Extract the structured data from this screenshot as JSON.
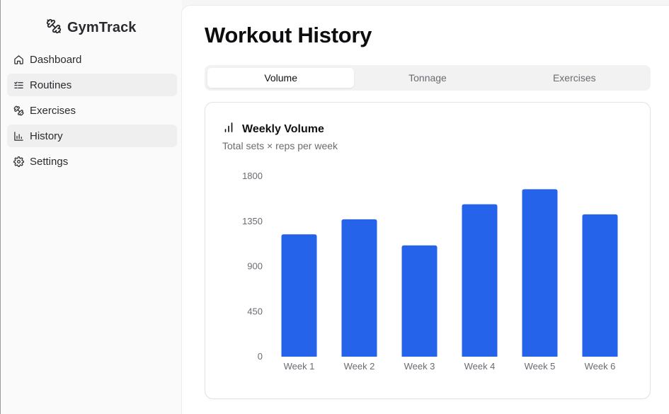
{
  "app": {
    "name": "GymTrack"
  },
  "sidebar": {
    "items": [
      {
        "label": "Dashboard",
        "icon": "home-icon",
        "active": false
      },
      {
        "label": "Routines",
        "icon": "checklist-icon",
        "active": true
      },
      {
        "label": "Exercises",
        "icon": "dumbbell-icon",
        "active": false
      },
      {
        "label": "History",
        "icon": "bar-chart-icon",
        "active": true
      },
      {
        "label": "Settings",
        "icon": "gear-icon",
        "active": false
      }
    ]
  },
  "main": {
    "title": "Workout History",
    "tabs": [
      {
        "label": "Volume",
        "active": true
      },
      {
        "label": "Tonnage",
        "active": false
      },
      {
        "label": "Exercises",
        "active": false
      }
    ],
    "card": {
      "title": "Weekly Volume",
      "subtitle": "Total sets × reps per week"
    }
  },
  "colors": {
    "bar": "#2563eb",
    "accent_text": "#111114"
  },
  "chart_data": {
    "type": "bar",
    "title": "Weekly Volume",
    "categories": [
      "Week 1",
      "Week 2",
      "Week 3",
      "Week 4",
      "Week 5",
      "Week 6"
    ],
    "values": [
      1220,
      1370,
      1110,
      1520,
      1670,
      1420
    ],
    "yticks": [
      0,
      450,
      900,
      1350,
      1800
    ],
    "ylim": [
      0,
      1800
    ],
    "xlabel": "",
    "ylabel": "",
    "grid": false,
    "legend": "none"
  }
}
